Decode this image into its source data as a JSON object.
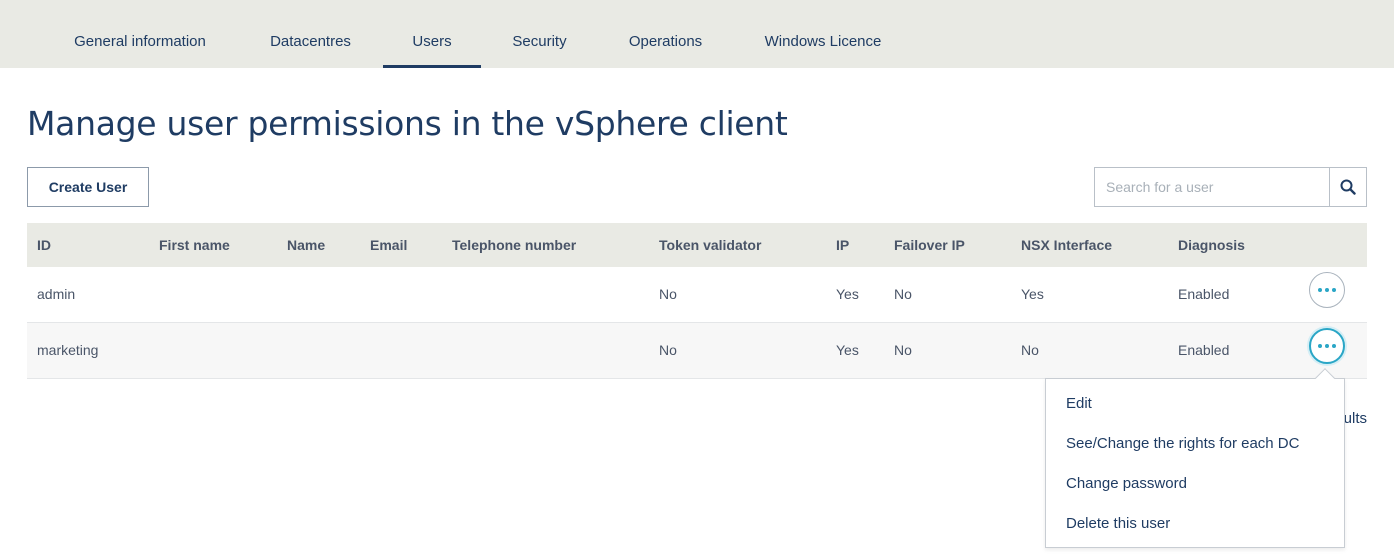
{
  "tabs": [
    {
      "label": "General information"
    },
    {
      "label": "Datacentres"
    },
    {
      "label": "Users"
    },
    {
      "label": "Security"
    },
    {
      "label": "Operations"
    },
    {
      "label": "Windows Licence"
    }
  ],
  "active_tab": "Users",
  "page": {
    "title": "Manage user permissions in the vSphere client"
  },
  "toolbar": {
    "create_label": "Create User"
  },
  "search": {
    "placeholder": "Search for a user",
    "value": "",
    "icon": "search-icon"
  },
  "table": {
    "columns": [
      "ID",
      "First name",
      "Name",
      "Email",
      "Telephone number",
      "Token validator",
      "IP",
      "Failover IP",
      "NSX Interface",
      "Diagnosis"
    ],
    "rows": [
      {
        "id": "admin",
        "first_name": "",
        "name": "",
        "email": "",
        "telephone": "",
        "token_validator": "No",
        "ip": "Yes",
        "failover_ip": "No",
        "nsx_interface": "Yes",
        "diagnosis": "Enabled"
      },
      {
        "id": "marketing",
        "first_name": "",
        "name": "",
        "email": "",
        "telephone": "",
        "token_validator": "No",
        "ip": "Yes",
        "failover_ip": "No",
        "nsx_interface": "No",
        "diagnosis": "Enabled"
      }
    ]
  },
  "footer": {
    "results_text_visible": "ults"
  },
  "context_menu": {
    "items": [
      {
        "label": "Edit"
      },
      {
        "label": "See/Change the rights for each DC"
      },
      {
        "label": "Change password"
      },
      {
        "label": "Delete this user"
      }
    ]
  },
  "colors": {
    "primary": "#1f3c63",
    "accent": "#2aa6c6",
    "tabbar_bg": "#e9eae4"
  }
}
